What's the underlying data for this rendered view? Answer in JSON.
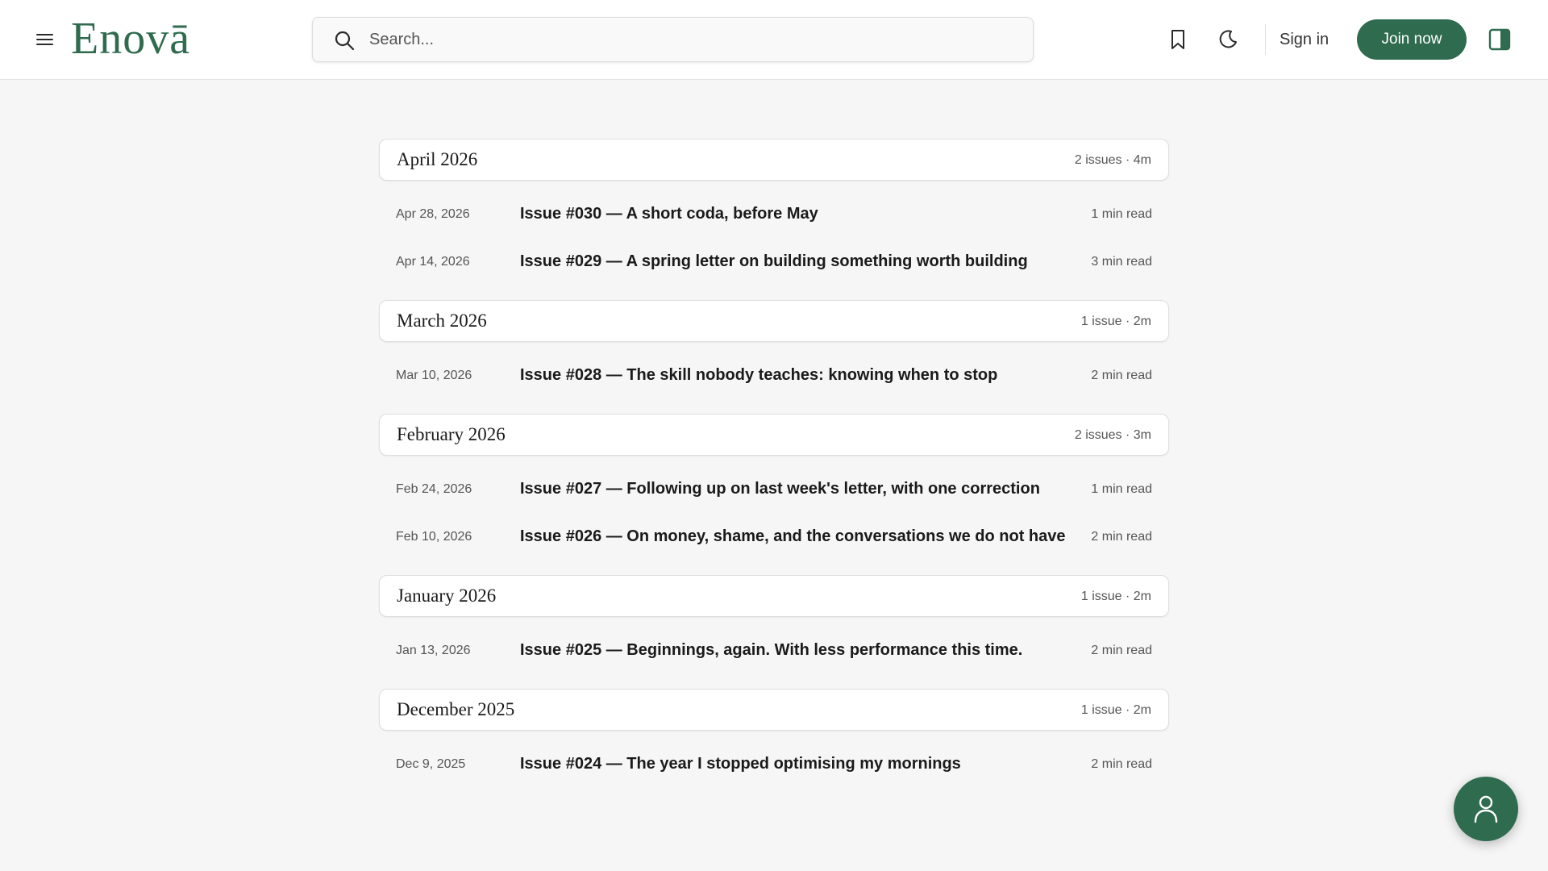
{
  "header": {
    "logo_text": "Enovā",
    "search": {
      "placeholder": "Search..."
    },
    "signin_label": "Sign in",
    "join_label": "Join now",
    "icons": [
      "menu-icon",
      "search-icon",
      "bookmark-icon",
      "moon-icon",
      "sidebar-panel-icon"
    ]
  },
  "colors": {
    "brand": "#2f6b4f",
    "background": "#f6f6f6"
  },
  "archive": {
    "months": [
      {
        "title": "April 2026",
        "meta": "2 issues · 4m",
        "issues": [
          {
            "date": "Apr 28, 2026",
            "title": "Issue #030 — A short coda, before May",
            "read": "1 min read"
          },
          {
            "date": "Apr 14, 2026",
            "title": "Issue #029 — A spring letter on building something worth building",
            "read": "3 min read"
          }
        ]
      },
      {
        "title": "March 2026",
        "meta": "1 issue · 2m",
        "issues": [
          {
            "date": "Mar 10, 2026",
            "title": "Issue #028 — The skill nobody teaches: knowing when to stop",
            "read": "2 min read"
          }
        ]
      },
      {
        "title": "February 2026",
        "meta": "2 issues · 3m",
        "issues": [
          {
            "date": "Feb 24, 2026",
            "title": "Issue #027 — Following up on last week's letter, with one correction",
            "read": "1 min read"
          },
          {
            "date": "Feb 10, 2026",
            "title": "Issue #026 — On money, shame, and the conversations we do not have",
            "read": "2 min read"
          }
        ]
      },
      {
        "title": "January 2026",
        "meta": "1 issue · 2m",
        "issues": [
          {
            "date": "Jan 13, 2026",
            "title": "Issue #025 — Beginnings, again. With less performance this time.",
            "read": "2 min read"
          }
        ]
      },
      {
        "title": "December 2025",
        "meta": "1 issue · 2m",
        "issues": [
          {
            "date": "Dec 9, 2025",
            "title": "Issue #024 — The year I stopped optimising my mornings",
            "read": "2 min read"
          }
        ]
      }
    ]
  },
  "fab": {
    "icon": "user-icon"
  }
}
